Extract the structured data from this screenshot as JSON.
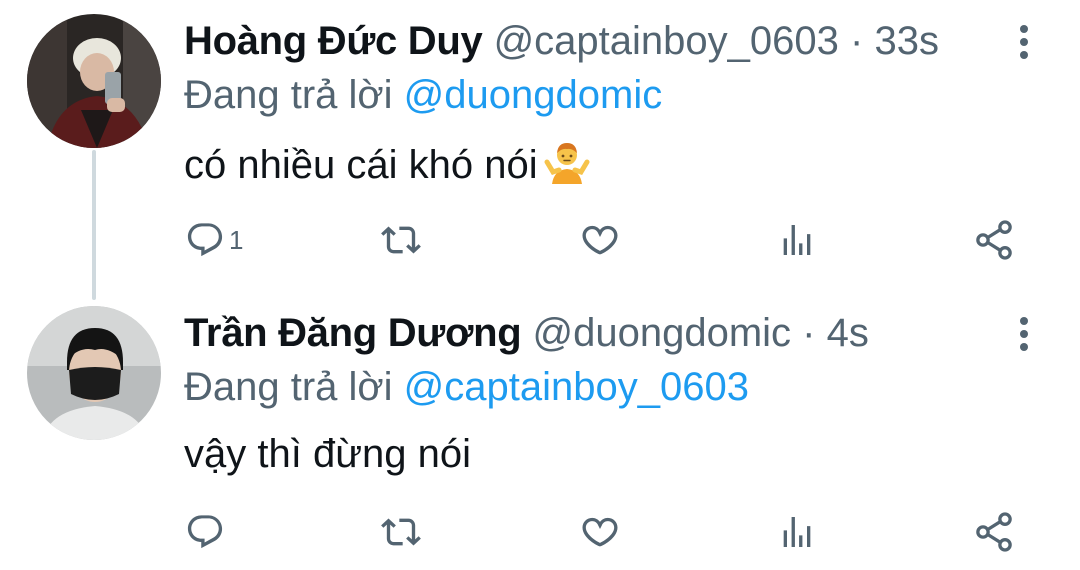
{
  "tweets": [
    {
      "display_name": "Hoàng Đức Duy",
      "handle": "@captainboy_0603",
      "separator": "·",
      "time": "33s",
      "reply_prefix": "Đang trả lời",
      "reply_to": "@duongdomic",
      "text": "có nhiều cái khó nói",
      "emoji_name": "person-shrugging-emoji",
      "reply_count": "1",
      "avatar_icon": "avatar-photo-light-hair"
    },
    {
      "display_name": "Trần Đăng Dương",
      "handle": "@duongdomic",
      "separator": "·",
      "time": "4s",
      "reply_prefix": "Đang trả lời",
      "reply_to": "@captainboy_0603",
      "text": "vậy thì đừng nói",
      "reply_count": "",
      "avatar_icon": "avatar-photo-black-mask"
    }
  ],
  "actions": {
    "reply_icon": "reply-icon",
    "retweet_icon": "retweet-icon",
    "like_icon": "heart-icon",
    "analytics_icon": "analytics-icon",
    "share_icon": "share-icon",
    "more_icon": "more-vertical-icon"
  },
  "colors": {
    "text": "#0f1419",
    "secondary": "#536471",
    "link": "#1d9bf0",
    "thread_line": "#cfd9de"
  }
}
